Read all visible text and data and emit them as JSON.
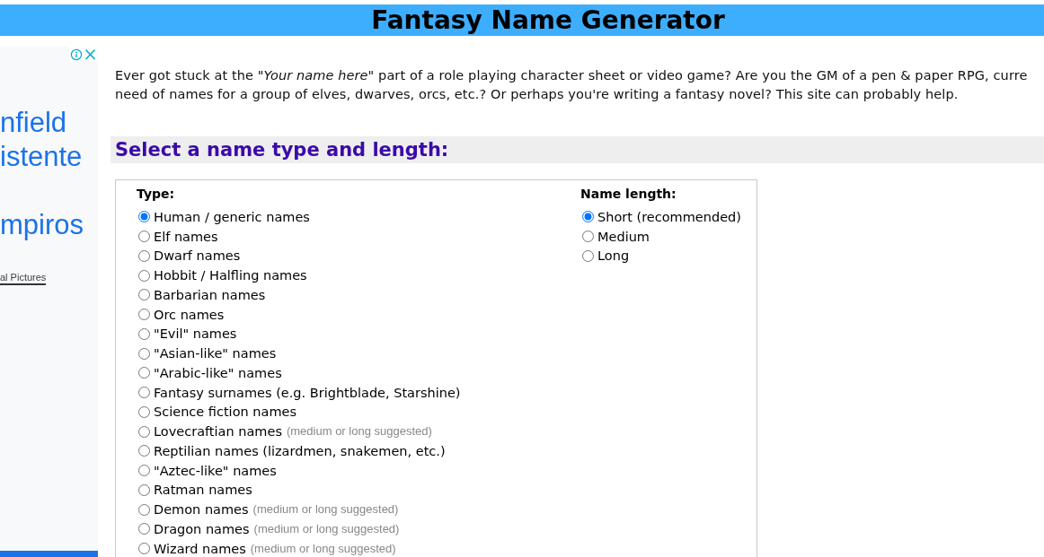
{
  "header": {
    "title": "Fantasy Name Generator"
  },
  "advertisement": {
    "text_groups": [
      [
        "nfield",
        "istente"
      ],
      [
        "mpiros"
      ]
    ],
    "credit": "al Pictures"
  },
  "intro": {
    "lines": [
      "Ever got stuck at the *\"Your name here\"* part of a role playing character sheet or video game? Are you the GM of a pen & paper RPG, curre",
      "need of names for a group of elves, dwarves, orcs, etc.? Or perhaps you're writing a fantasy novel? This site can probably help."
    ]
  },
  "section_heading": "Select a name type and length:",
  "form": {
    "type": {
      "label": "Type:",
      "options": [
        {
          "label": "Human / generic names",
          "selected": true
        },
        {
          "label": "Elf names",
          "selected": false
        },
        {
          "label": "Dwarf names",
          "selected": false
        },
        {
          "label": "Hobbit / Halfling names",
          "selected": false
        },
        {
          "label": "Barbarian names",
          "selected": false
        },
        {
          "label": "Orc names",
          "selected": false
        },
        {
          "label": "\"Evil\" names",
          "selected": false
        },
        {
          "label": "\"Asian-like\" names",
          "selected": false
        },
        {
          "label": "\"Arabic-like\" names",
          "selected": false
        },
        {
          "label": "Fantasy surnames (e.g. Brightblade, Starshine)",
          "selected": false
        },
        {
          "label": "Science fiction names",
          "selected": false
        },
        {
          "label": "Lovecraftian names",
          "hint": "(medium or long suggested)",
          "selected": false
        },
        {
          "label": "Reptilian names (lizardmen, snakemen, etc.)",
          "selected": false
        },
        {
          "label": "\"Aztec-like\" names",
          "selected": false
        },
        {
          "label": "Ratman names",
          "selected": false
        },
        {
          "label": "Demon names",
          "hint": "(medium or long suggested)",
          "selected": false
        },
        {
          "label": "Dragon names",
          "hint": "(medium or long suggested)",
          "selected": false
        },
        {
          "label": "Wizard names",
          "hint": "(medium or long suggested)",
          "selected": false
        }
      ]
    },
    "length": {
      "label": "Name length:",
      "options": [
        {
          "label": "Short (recommended)",
          "selected": true
        },
        {
          "label": "Medium",
          "selected": false
        },
        {
          "label": "Long",
          "selected": false
        }
      ]
    }
  }
}
